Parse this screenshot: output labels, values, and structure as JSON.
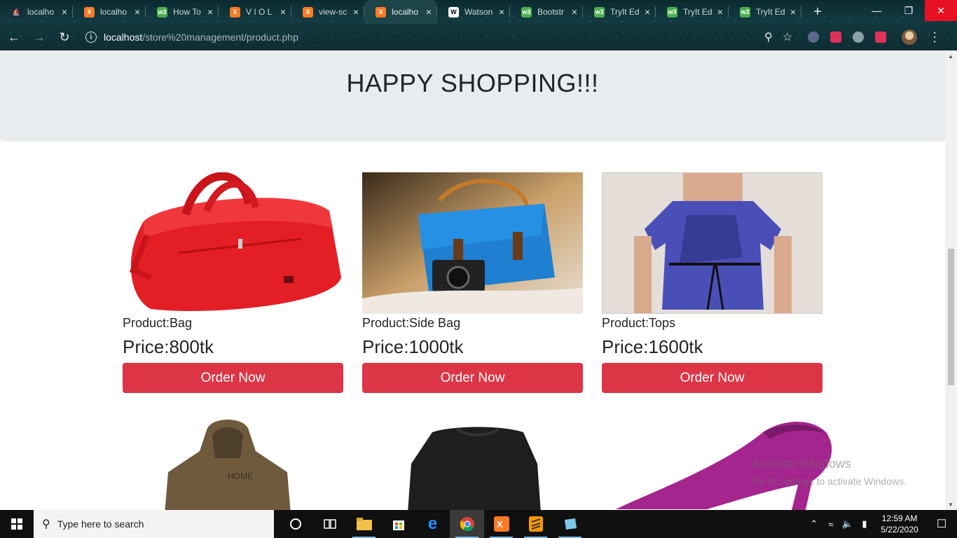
{
  "browser": {
    "tabs": [
      {
        "title": "localho",
        "favicon": "sail-icon",
        "active": false
      },
      {
        "title": "localho",
        "favicon": "xampp-icon",
        "active": false
      },
      {
        "title": "How To",
        "favicon": "w3-icon",
        "active": false
      },
      {
        "title": "V I O L",
        "favicon": "xampp-icon",
        "active": false
      },
      {
        "title": "view-sc",
        "favicon": "xampp-icon",
        "active": false
      },
      {
        "title": "localho",
        "favicon": "xampp-icon",
        "active": true
      },
      {
        "title": "Watson",
        "favicon": "wikipedia-icon",
        "active": false
      },
      {
        "title": "Bootstr",
        "favicon": "w3-icon",
        "active": false
      },
      {
        "title": "TryIt Ed",
        "favicon": "w3-icon",
        "active": false
      },
      {
        "title": "TryIt Ed",
        "favicon": "w3-icon",
        "active": false
      },
      {
        "title": "TryIt Ed",
        "favicon": "w3-icon",
        "active": false
      }
    ],
    "url_host": "localhost",
    "url_path": "/store%20management/product.php"
  },
  "page": {
    "heading": "HAPPY SHOPPING!!!",
    "products": [
      {
        "name": "Product:Bag",
        "price": "Price:800tk",
        "button": "Order Now"
      },
      {
        "name": "Product:Side Bag",
        "price": "Price:1000tk",
        "button": "Order Now"
      },
      {
        "name": "Product:Tops",
        "price": "Price:1600tk",
        "button": "Order Now"
      }
    ],
    "colors": {
      "jumbotron": "#e9ecef",
      "button": "#dc3545"
    }
  },
  "watermark": {
    "line1": "Activate Windows",
    "line2": "Go to Settings to activate Windows."
  },
  "taskbar": {
    "search_placeholder": "Type here to search",
    "time": "12:59 AM",
    "date": "5/22/2020"
  }
}
